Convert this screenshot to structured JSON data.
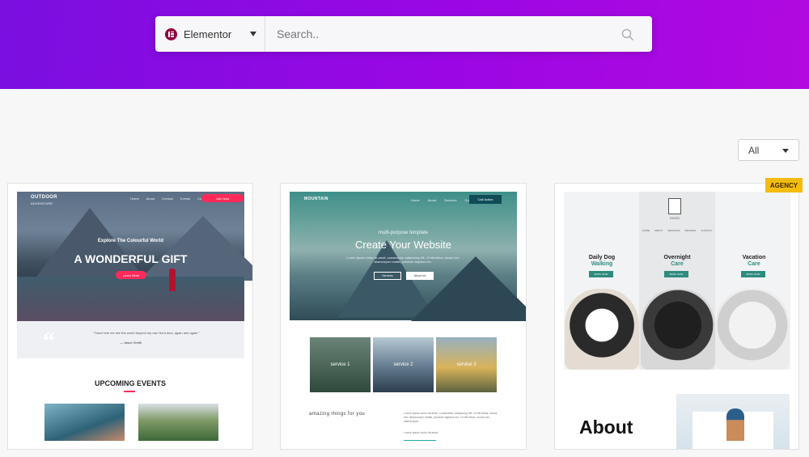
{
  "search": {
    "builder_label": "Elementor",
    "placeholder": "Search.."
  },
  "filter": {
    "selected": "All"
  },
  "cards": [
    {
      "logo_line1": "OUTDOOR",
      "logo_line2": "ADVENTURE",
      "kicker": "Explore The Colourful World",
      "title": "A WONDERFUL GIFT",
      "section_title": "UPCOMING EVENTS"
    },
    {
      "logo": "MOUNTAIN",
      "kicker": "multi-purpose template",
      "title": "Create Your Website",
      "services": [
        "service 1",
        "service 2",
        "service 3"
      ],
      "tagline": "amazing things for you"
    },
    {
      "badge": "AGENCY",
      "services": [
        {
          "line1": "Daily Dog",
          "line2": "Walking"
        },
        {
          "line1": "Overnight",
          "line2": "Care"
        },
        {
          "line1": "Vacation",
          "line2": "Care"
        }
      ],
      "about": "About"
    }
  ],
  "colors": {
    "hero_start": "#7a0fe0",
    "hero_end": "#b209e0",
    "badge": "#f5bb0e",
    "elementor": "#92003b"
  }
}
